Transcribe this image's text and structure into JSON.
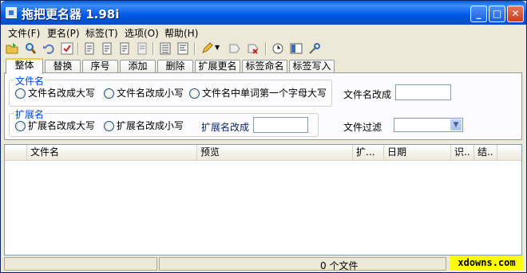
{
  "window": {
    "title": "拖把更名器 1.98i",
    "min_label": "_",
    "max_label": "□",
    "close_label": "✕"
  },
  "menus": [
    "文件(F)",
    "更名(P)",
    "标签(T)",
    "选项(O)",
    "帮助(H)"
  ],
  "toolbar_icons": [
    "open-folder-icon",
    "search-icon",
    "undo-icon",
    "check-icon",
    "file-rename-icon-1",
    "file-rename-icon-2",
    "file-rename-icon-3",
    "file-rename-icon-4",
    "list-icon",
    "list-edit-icon",
    "pencil-icon",
    "dropdown-arrow-icon",
    "tag-edit-icon",
    "tag-delete-icon",
    "clock-icon",
    "panel-icon",
    "tools-icon"
  ],
  "tabs": [
    "整体",
    "替换",
    "序号",
    "添加",
    "删除",
    "扩展更名",
    "标签命名",
    "标签写入"
  ],
  "filename_group": {
    "label": "文件名",
    "options": [
      "文件名改成大写",
      "文件名改成小写",
      "文件名中单词第一个字母大写"
    ],
    "rename_label": "文件名改成",
    "rename_value": ""
  },
  "ext_group": {
    "label": "扩展名",
    "options": [
      "扩展名改成大写",
      "扩展名改成小写"
    ],
    "rename_label": "扩展名改成",
    "rename_value": ""
  },
  "filter": {
    "label": "文件过滤",
    "value": ""
  },
  "list_columns": [
    "文件名",
    "预览",
    "扩...",
    "日期",
    "识..",
    "结.."
  ],
  "status": {
    "count": "0 个文件"
  },
  "watermark": "xdowns.com",
  "colors": {
    "title_bar": "#0058e6",
    "group_label": "#0046d5",
    "watermark_bg": "#ffff00"
  }
}
